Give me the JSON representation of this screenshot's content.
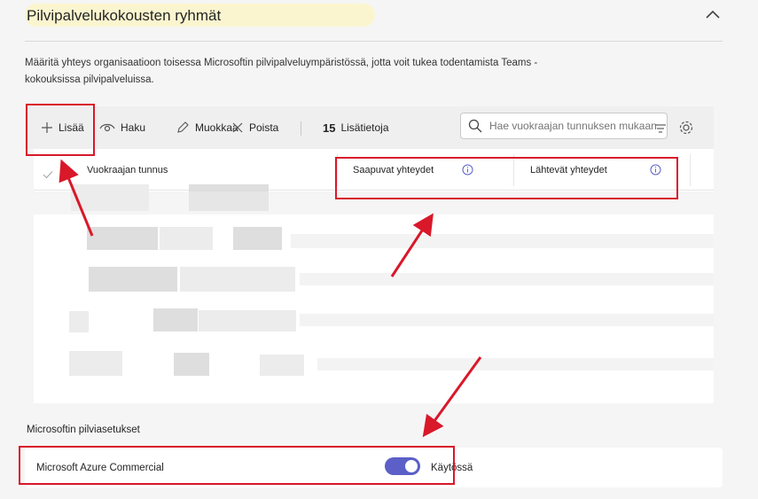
{
  "section": {
    "title": "Pilvipalvelukokousten ryhmät",
    "collapse_icon": "chevron-up-icon"
  },
  "description": "Määritä yhteys organisaatioon toisessa Microsoftin pilvipalveluympäristössä, jotta voit tukea todentamista Teams -kokouksissa pilvipalveluissa.",
  "toolbar": {
    "add_label": "Lisää",
    "view_label": "Haku",
    "edit_label": "Muokkaa",
    "delete_label": "Poista",
    "count": "15",
    "details_label": "Lisätietoja",
    "search_placeholder": "Hae vuokraajan tunnuksen mukaan"
  },
  "table": {
    "columns": [
      "Vuokraajan tunnus",
      "Saapuvat yhteydet",
      "Lähtevät yhteydet"
    ]
  },
  "cloud_settings": {
    "heading": "Microsoftin pilviasetukset",
    "rows": [
      {
        "name": "Microsoft Azure Commercial",
        "enabled": true,
        "status": "Käytössä"
      }
    ]
  },
  "colors": {
    "accent": "#5b5fc7",
    "highlight": "#d9182a",
    "section_header_bg": "#fbf5cf"
  }
}
